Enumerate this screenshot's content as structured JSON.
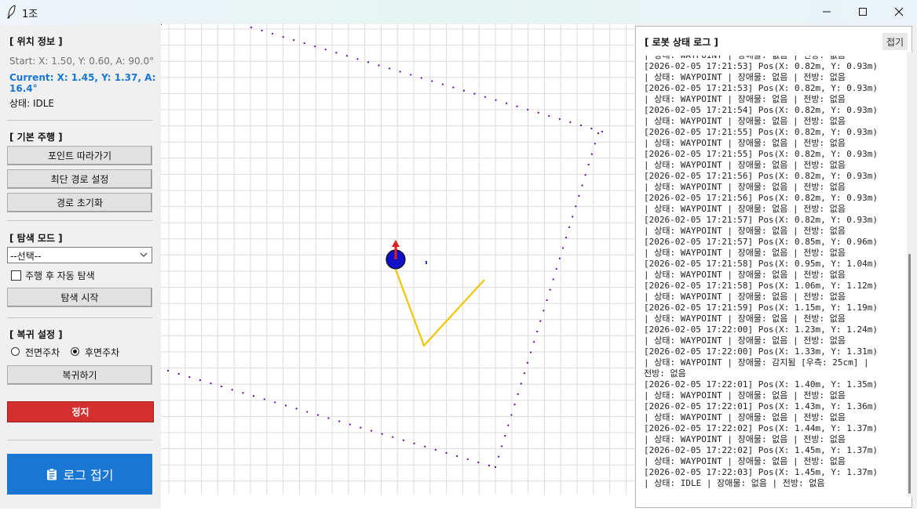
{
  "window": {
    "title": "1조",
    "controls": [
      "minimize-icon",
      "maximize-icon",
      "close-icon"
    ]
  },
  "sidebar": {
    "position": {
      "title": "[ 위치 정보 ]",
      "start": "Start: X: 1.50, Y: 0.60, A: 90.0°",
      "current": "Current: X: 1.45, Y: 1.37, A: 16.4°",
      "status": "상태: IDLE"
    },
    "drive": {
      "title": "[ 기본 주행 ]",
      "follow_points": "포인트 따라가기",
      "shortest_path": "최단 경로 설정",
      "reset_path": "경로 초기화"
    },
    "explore": {
      "title": "[ 탐색 모드 ]",
      "select_value": "--선택--",
      "auto_explore_label": "주행 후 자동 탐색",
      "auto_explore_checked": false,
      "start_button": "탐색 시작"
    },
    "return": {
      "title": "[ 복귀 설정 ]",
      "front_label": "전면주차",
      "rear_label": "후면주차",
      "selected": "rear",
      "return_button": "복귀하기"
    },
    "stop_button": "정지",
    "log_collapse_button": "로그 접기",
    "colors": {
      "stop": "#d32f2f",
      "log_button": "#1976d2",
      "current_text": "#1976d2"
    }
  },
  "map": {
    "grid": true,
    "robot_color": "#1010c8",
    "heading_color": "#e02020",
    "path_color": "#f5c400",
    "boundary_color": "#5b00a8"
  },
  "log": {
    "title": "[ 로봇 상태 로그 ]",
    "collapse_label": "접기",
    "lines": [
      "| 상태: WAYPOINT | 장애물: 없음 | 전방: 없음",
      "[2026-02-05 17:21:53] Pos(X: 0.82m, Y: 0.93m)",
      "| 상태: WAYPOINT | 장애물: 없음 | 전방: 없음",
      "[2026-02-05 17:21:53] Pos(X: 0.82m, Y: 0.93m)",
      "| 상태: WAYPOINT | 장애물: 없음 | 전방: 없음",
      "[2026-02-05 17:21:54] Pos(X: 0.82m, Y: 0.93m)",
      "| 상태: WAYPOINT | 장애물: 없음 | 전방: 없음",
      "[2026-02-05 17:21:55] Pos(X: 0.82m, Y: 0.93m)",
      "| 상태: WAYPOINT | 장애물: 없음 | 전방: 없음",
      "[2026-02-05 17:21:55] Pos(X: 0.82m, Y: 0.93m)",
      "| 상태: WAYPOINT | 장애물: 없음 | 전방: 없음",
      "[2026-02-05 17:21:56] Pos(X: 0.82m, Y: 0.93m)",
      "| 상태: WAYPOINT | 장애물: 없음 | 전방: 없음",
      "[2026-02-05 17:21:56] Pos(X: 0.82m, Y: 0.93m)",
      "| 상태: WAYPOINT | 장애물: 없음 | 전방: 없음",
      "[2026-02-05 17:21:57] Pos(X: 0.82m, Y: 0.93m)",
      "| 상태: WAYPOINT | 장애물: 없음 | 전방: 없음",
      "[2026-02-05 17:21:57] Pos(X: 0.85m, Y: 0.96m)",
      "| 상태: WAYPOINT | 장애물: 없음 | 전방: 없음",
      "[2026-02-05 17:21:58] Pos(X: 0.95m, Y: 1.04m)",
      "| 상태: WAYPOINT | 장애물: 없음 | 전방: 없음",
      "[2026-02-05 17:21:58] Pos(X: 1.06m, Y: 1.12m)",
      "| 상태: WAYPOINT | 장애물: 없음 | 전방: 없음",
      "[2026-02-05 17:21:59] Pos(X: 1.15m, Y: 1.19m)",
      "| 상태: WAYPOINT | 장애물: 없음 | 전방: 없음",
      "[2026-02-05 17:22:00] Pos(X: 1.23m, Y: 1.24m)",
      "| 상태: WAYPOINT | 장애물: 없음 | 전방: 없음",
      "[2026-02-05 17:22:00] Pos(X: 1.33m, Y: 1.31m)",
      "| 상태: WAYPOINT | 장애물: 감지됨 [우측: 25cm] |",
      "전방: 없음",
      "[2026-02-05 17:22:01] Pos(X: 1.40m, Y: 1.35m)",
      "| 상태: WAYPOINT | 장애물: 없음 | 전방: 없음",
      "[2026-02-05 17:22:01] Pos(X: 1.43m, Y: 1.36m)",
      "| 상태: WAYPOINT | 장애물: 없음 | 전방: 없음",
      "[2026-02-05 17:22:02] Pos(X: 1.44m, Y: 1.37m)",
      "| 상태: WAYPOINT | 장애물: 없음 | 전방: 없음",
      "[2026-02-05 17:22:02] Pos(X: 1.45m, Y: 1.37m)",
      "| 상태: WAYPOINT | 장애물: 없음 | 전방: 없음",
      "[2026-02-05 17:22:03] Pos(X: 1.45m, Y: 1.37m)",
      "| 상태: IDLE | 장애물: 없음 | 전방: 없음"
    ]
  }
}
